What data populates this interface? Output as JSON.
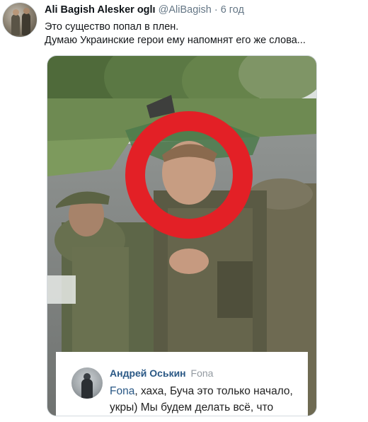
{
  "tweet": {
    "display_name": "Ali Bagish Alesker oglı",
    "handle": "@AliBagish",
    "separator": "·",
    "time": "6 год",
    "text_line1": "Это существо попал в плен.",
    "text_line2": "Думаю Украинские герои ему напомнят его же слова..."
  },
  "media": {
    "icon": "photo-of-captured-soldiers",
    "highlight_color": "#e32026",
    "comment": {
      "author": "Андрей Оськин",
      "reply_to": "Fona",
      "mention": "Fona",
      "line1_rest": ", хаха, Буча это только начало,",
      "line2": "укры) Мы будем делать всё, что"
    }
  },
  "colors": {
    "name": "#0f1419",
    "muted": "#657786",
    "link": "#2a5885"
  }
}
